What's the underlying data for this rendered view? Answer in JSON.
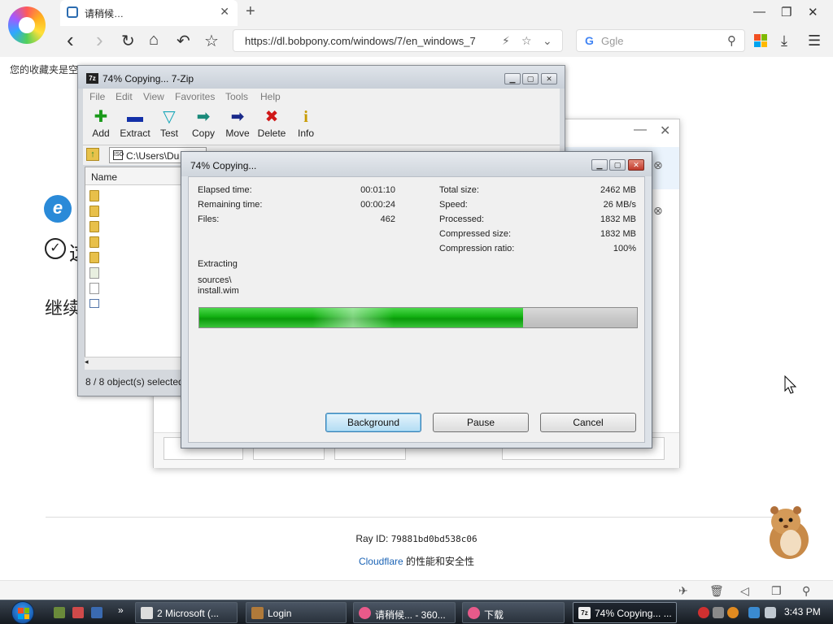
{
  "browser": {
    "tab_title": "请稍候…",
    "tab_close": "✕",
    "new_tab": "+",
    "window_controls": {
      "minimize": "—",
      "restore": "❐",
      "close": "✕"
    },
    "nav": {
      "back": "‹",
      "forward": "›",
      "refresh": "↻",
      "home": "⌂",
      "undo": "↶",
      "star": "☆"
    },
    "address": "https://dl.bobpony.com/windows/7/en_windows_7",
    "search_placeholder": "Ggle",
    "search_logo": "G",
    "bookmarks_text": "您的收藏夹是空"
  },
  "page": {
    "check_text": "这",
    "continue_text": "继续",
    "ray_label": "Ray ID: ",
    "ray_id": "79881bd0bd538c06",
    "cloudflare_link": "Cloudflare",
    "cloudflare_text": " 的性能和安全性"
  },
  "sevenzip": {
    "title": "74% Copying... 7-Zip",
    "app_icon_text": "7z",
    "menu": [
      "File",
      "Edit",
      "View",
      "Favorites",
      "Tools",
      "Help"
    ],
    "toolbar": [
      {
        "label": "Add",
        "icon": "add-icon",
        "glyph": "✚",
        "color": "#1a9a1a"
      },
      {
        "label": "Extract",
        "icon": "extract-icon",
        "glyph": "▬",
        "color": "#1330a8"
      },
      {
        "label": "Test",
        "icon": "test-icon",
        "glyph": "▽",
        "color": "#17a6b8"
      },
      {
        "label": "Copy",
        "icon": "copy-icon",
        "glyph": "➡",
        "color": "#1a8a7a"
      },
      {
        "label": "Move",
        "icon": "move-icon",
        "glyph": "➡",
        "color": "#1a2a8a"
      },
      {
        "label": "Delete",
        "icon": "delete-icon",
        "glyph": "✖",
        "color": "#d01818"
      },
      {
        "label": "Info",
        "icon": "info-icon",
        "glyph": "i",
        "color": "#c89a00"
      }
    ],
    "path": "C:\\Users\\Du",
    "column_name": "Name",
    "status": "8 / 8 object(s) selected"
  },
  "progress": {
    "title": "74% Copying...",
    "elapsed_label": "Elapsed time:",
    "elapsed_value": "00:01:10",
    "remaining_label": "Remaining time:",
    "remaining_value": "00:00:24",
    "files_label": "Files:",
    "files_value": "462",
    "total_label": "Total size:",
    "total_value": "2462 MB",
    "speed_label": "Speed:",
    "speed_value": "26 MB/s",
    "processed_label": "Processed:",
    "processed_value": "1832 MB",
    "compressed_label": "Compressed size:",
    "compressed_value": "1832 MB",
    "ratio_label": "Compression ratio:",
    "ratio_value": "100%",
    "action": "Extracting",
    "path_line1": "sources\\",
    "path_line2": "install.wim",
    "percent": 74,
    "buttons": {
      "background": "Background",
      "pause": "Pause",
      "cancel": "Cancel"
    }
  },
  "taskbar": {
    "tasks": [
      {
        "label": "2 Microsoft (...",
        "icon": "window-icon",
        "color": "#ddd"
      },
      {
        "label": "Login",
        "icon": "hamster-icon",
        "color": "#b07a3a"
      },
      {
        "label": "请稍候... - 360...",
        "icon": "browser-icon",
        "color": "#e85a8a"
      },
      {
        "label": "下载",
        "icon": "browser-icon",
        "color": "#e85a8a"
      },
      {
        "label": "74% Copying... ...",
        "icon": "sevenzip-icon",
        "color": "#222"
      }
    ],
    "time": "3:43 PM"
  },
  "colors": {
    "progress_fill": "#12b012",
    "link": "#1b63b5"
  }
}
